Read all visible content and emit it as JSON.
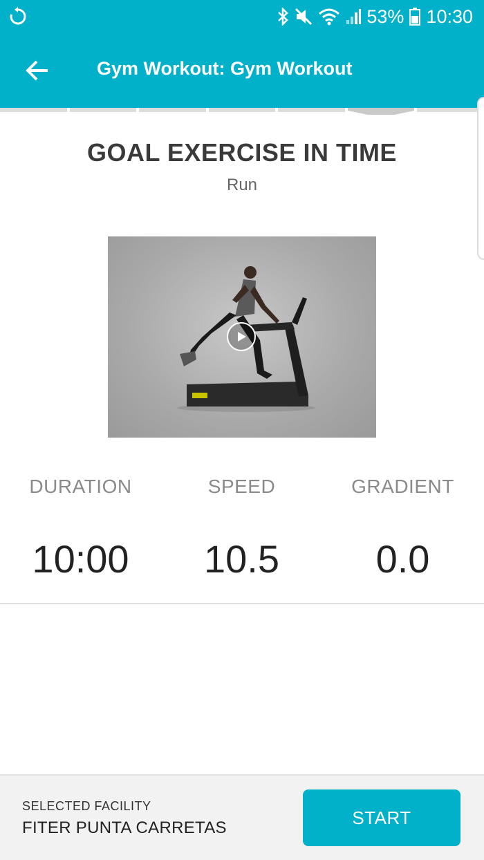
{
  "status_bar": {
    "battery_percent": "53%",
    "time": "10:30",
    "icons": [
      "sync-icon",
      "bluetooth-icon",
      "mute-icon",
      "wifi-icon",
      "signal-icon",
      "battery-icon"
    ]
  },
  "app_bar": {
    "title": "Gym Workout: Gym Workout",
    "back_icon": "arrow-left-icon"
  },
  "steps": {
    "count": 7,
    "active_index": 5
  },
  "exercise": {
    "title": "GOAL EXERCISE IN TIME",
    "subtitle": "Run",
    "video_icon": "play-icon"
  },
  "stats": [
    {
      "label": "DURATION",
      "value": "10:00"
    },
    {
      "label": "SPEED",
      "value": "10.5"
    },
    {
      "label": "GRADIENT",
      "value": "0.0"
    }
  ],
  "footer": {
    "facility_label": "SELECTED FACILITY",
    "facility_name": "FITER PUNTA CARRETAS",
    "start_label": "START"
  },
  "colors": {
    "accent": "#00b1c9",
    "footer_bg": "#f2f2f2"
  }
}
